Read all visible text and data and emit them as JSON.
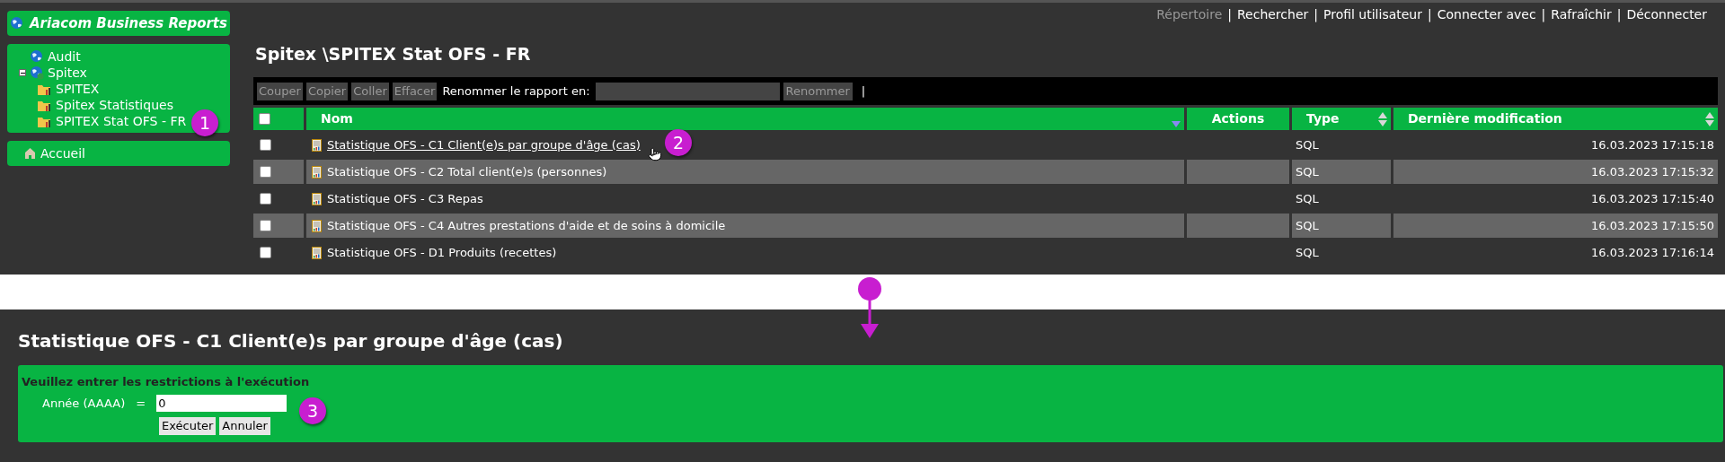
{
  "sidebar": {
    "app_title": "Ariacom Business Reports",
    "tree": [
      {
        "label": "Audit",
        "kind": "server"
      },
      {
        "label": "Spitex",
        "kind": "server",
        "expanded": true,
        "children": [
          {
            "label": "SPITEX",
            "kind": "folder"
          },
          {
            "label": "Spitex Statistiques",
            "kind": "folder"
          },
          {
            "label": "SPITEX Stat OFS - FR",
            "kind": "folder"
          }
        ]
      }
    ],
    "home": "Accueil"
  },
  "top_nav": [
    {
      "label": "Répertoire",
      "disabled": true
    },
    {
      "separator_before": "|",
      "label": "Rechercher",
      "disabled": false
    },
    {
      "separator_before": "|",
      "label": "Profil utilisateur",
      "disabled": false
    },
    {
      "separator_before": "|",
      "label": "Connecter avec",
      "disabled": false
    },
    {
      "separator_before": "|",
      "label": "Rafraîchir",
      "disabled": false
    },
    {
      "separator_before": "|",
      "label": "Déconnecter",
      "disabled": false
    }
  ],
  "folder_title": "Spitex \\SPITEX Stat OFS - FR",
  "toolbar": {
    "buttons": [
      "Couper",
      "Copier",
      "Coller",
      "Effacer"
    ],
    "rename_label": "Renommer le rapport en:",
    "rename_button": "Renommer",
    "separator": "|"
  },
  "table": {
    "select_all_checked": false,
    "columns": [
      {
        "label": "Nom",
        "sortable": true,
        "sorted_descending": true
      },
      {
        "label": "Actions",
        "sortable": false
      },
      {
        "label": "Type",
        "sortable": true,
        "sorted_descending": false
      },
      {
        "label": "Dernière modification",
        "sortable": true,
        "sorted_descending": false
      }
    ],
    "rows": [
      {
        "name": "Statistique OFS - C1 Client(e)s par groupe d'âge (cas)",
        "type": "SQL",
        "modified": "16.03.2023 17:15:18",
        "checked": false,
        "hovered": true
      },
      {
        "name": "Statistique OFS - C2 Total client(e)s (personnes)",
        "type": "SQL",
        "modified": "16.03.2023 17:15:32",
        "checked": false,
        "hovered": false
      },
      {
        "name": "Statistique OFS - C3 Repas",
        "type": "SQL",
        "modified": "16.03.2023 17:15:40",
        "checked": false,
        "hovered": false
      },
      {
        "name": "Statistique OFS - C4 Autres prestations d'aide et de soins à domicile",
        "type": "SQL",
        "modified": "16.03.2023 17:15:50",
        "checked": false,
        "hovered": false
      },
      {
        "name": "Statistique OFS - D1 Produits (recettes)",
        "type": "SQL",
        "modified": "16.03.2023 17:16:14",
        "checked": false,
        "hovered": false
      }
    ]
  },
  "report": {
    "title": "Statistique OFS - C1 Client(e)s par groupe d'âge (cas)",
    "prompt": "Veuillez entrer les restrictions à l'exécution",
    "field_label": "Année (AAAA)",
    "equals": "=",
    "field_value": "0",
    "buttons": [
      "Exécuter",
      "Annuler"
    ]
  },
  "callouts": [
    "1",
    "2",
    "3"
  ]
}
